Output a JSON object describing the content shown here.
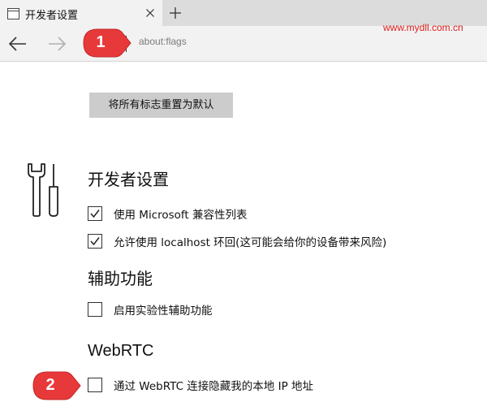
{
  "tab": {
    "title": "开发者设置",
    "favicon": "page-icon",
    "close_icon": "close-icon"
  },
  "new_tab_icon": "plus-icon",
  "toolbar": {
    "back_icon": "arrow-left-icon",
    "forward_icon": "arrow-right-icon",
    "address": "about:flags"
  },
  "watermark": "www.mydll.com.cn",
  "reset_button": "将所有标志重置为默认",
  "sections": {
    "developer": {
      "icon": "tools-icon",
      "heading": "开发者设置",
      "options": [
        {
          "label": "使用 Microsoft 兼容性列表",
          "checked": true
        },
        {
          "label": "允许使用 localhost 环回(这可能会给你的设备带来风险)",
          "checked": true
        }
      ]
    },
    "accessibility": {
      "heading": "辅助功能",
      "options": [
        {
          "label": "启用实验性辅助功能",
          "checked": false
        }
      ]
    },
    "webrtc": {
      "heading": "WebRTC",
      "options": [
        {
          "label": "通过 WebRTC 连接隐藏我的本地 IP 地址",
          "checked": false
        }
      ]
    }
  },
  "annotations": [
    {
      "number": "1",
      "color": "#e8393a"
    },
    {
      "number": "2",
      "color": "#e8393a"
    }
  ]
}
